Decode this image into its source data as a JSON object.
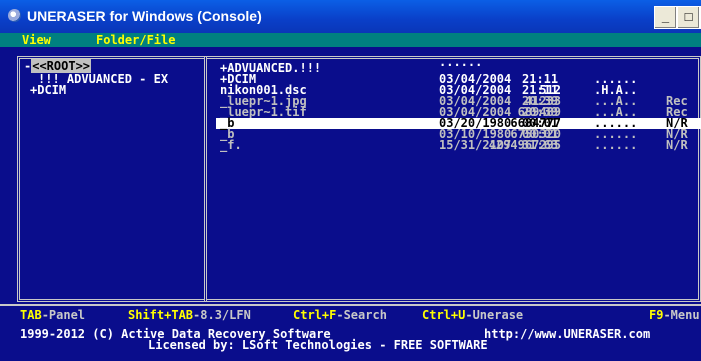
{
  "window": {
    "title": "UNERASER for Windows (Console)",
    "controls": [
      "_",
      "□",
      "×"
    ]
  },
  "menu": [
    "View",
    "Folder/File"
  ],
  "tree": {
    "root": "<<ROOT>>",
    "items": [
      "!!! ADVUANCED - EX",
      "+DCIM"
    ]
  },
  "files": {
    "header_dots": "......",
    "rows": [
      {
        "name": "+ADVUANCED.!!!",
        "size": "",
        "date": "",
        "time": "",
        "attr": "",
        "status": ""
      },
      {
        "name": "+DCIM",
        "size": "",
        "date": "03/04/2004",
        "time": "21:11",
        "attr": "......",
        "status": ""
      },
      {
        "name": "nikon001.dsc",
        "size": "512",
        "date": "03/04/2004",
        "time": "21:11",
        "attr": ".H.A..",
        "status": ""
      },
      {
        "name": "_luepr~1.jpg",
        "size": "41233",
        "date": "03/04/2004",
        "time": "20:39",
        "attr": "...A..",
        "status": "Rec"
      },
      {
        "name": "_luepr~1.tif",
        "size": "689489",
        "date": "03/04/2004",
        "time": "20:39",
        "attr": "...A..",
        "status": "Rec"
      },
      {
        "name": "_b",
        "size": "6684777",
        "date": "03/20/1980",
        "time": "00:01",
        "attr": "......",
        "status": "N/R"
      },
      {
        "name": "_b",
        "size": "6750320",
        "date": "03/10/1980",
        "time": "00:01",
        "attr": "......",
        "status": "N/R"
      },
      {
        "name": "_f.",
        "size": "4294967295",
        "date": "15/31/2107",
        "time": "31:63",
        "attr": "......",
        "status": "N/R"
      }
    ]
  },
  "status": {
    "tab_key": "TAB",
    "tab_label": "-Panel",
    "shift_key": "Shift+TAB",
    "shift_label": "-8.3/LFN",
    "ctrlf_key": "Ctrl+F",
    "ctrlf_label": "-Search",
    "ctrlu_key": "Ctrl+U",
    "ctrlu_label": "-Unerase",
    "f9_key": "F9",
    "f9_label": "-Menu"
  },
  "footer": {
    "copyright": "1999-2012 (C) Active Data Recovery Software",
    "url": "http://www.UNERASER.com",
    "license": "Licensed by: LSoft Technologies - FREE SOFTWARE"
  },
  "colors": {
    "background": "#0a0d8c",
    "menubar": "#008080",
    "hotkey": "#ffff00",
    "titlebar": "#0a46d0"
  }
}
